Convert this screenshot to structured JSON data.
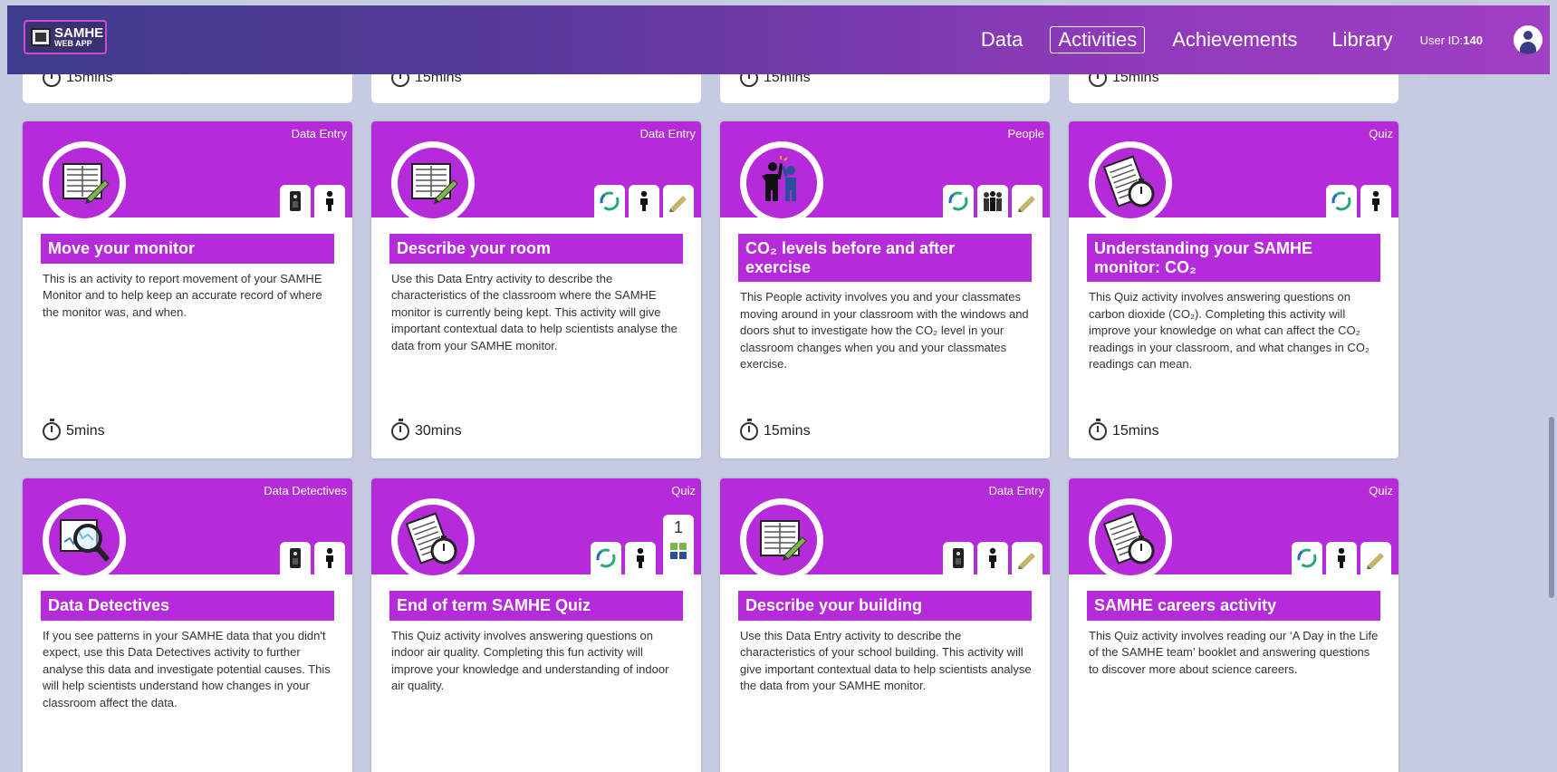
{
  "header": {
    "logo_title": "SAMHE",
    "logo_sub": "WEB APP",
    "nav": [
      {
        "label": "Data"
      },
      {
        "label": "Activities"
      },
      {
        "label": "Achievements"
      },
      {
        "label": "Library"
      }
    ],
    "user_id_label": "User ID:",
    "user_id_value": "140"
  },
  "partial_row": [
    {
      "duration": "15mins"
    },
    {
      "duration": "15mins"
    },
    {
      "duration": "15mins"
    },
    {
      "duration": "15mins"
    }
  ],
  "cards": [
    {
      "category": "Data Entry",
      "title": "Move your monitor",
      "description": "This is an activity to report movement of your SAMHE Monitor and to help keep an accurate record of where the monitor was, and when.",
      "duration": "5mins",
      "icon": "data-entry-sheet-icon",
      "badges": [
        "monitor-icon",
        "person-icon"
      ]
    },
    {
      "category": "Data Entry",
      "title": "Describe your room",
      "description": "Use this Data Entry activity to describe the characteristics of the classroom where the SAMHE monitor is currently being kept. This activity will give important contextual data to help scientists analyse the data from your SAMHE monitor.",
      "duration": "30mins",
      "icon": "data-entry-sheet-icon",
      "badges": [
        "repeat-icon",
        "person-icon",
        "pencil-icon"
      ]
    },
    {
      "category": "People",
      "title": "CO₂ levels before and after exercise",
      "description": "This People activity involves you and your classmates moving around in your classroom with the windows and doors shut to investigate how the CO₂ level in your classroom changes when you and your classmates exercise.",
      "duration": "15mins",
      "icon": "people-high-five-icon",
      "badges": [
        "repeat-icon",
        "group-icon",
        "pencil-icon"
      ]
    },
    {
      "category": "Quiz",
      "title": "Understanding your SAMHE monitor: CO₂",
      "description": "This Quiz activity involves answering questions on carbon dioxide (CO₂). Completing this activity will improve your knowledge on what can affect the CO₂ readings in your classroom, and what changes in CO₂ readings can mean.",
      "duration": "15mins",
      "icon": "quiz-sheet-icon",
      "badges": [
        "repeat-icon",
        "person-icon"
      ]
    },
    {
      "category": "Data Detectives",
      "title": "Data Detectives",
      "description": "If you see patterns in your SAMHE data that you didn't expect, use this Data Detectives activity to further analyse this data and investigate potential causes. This will help scientists understand how changes in your classroom affect the data.",
      "duration": "",
      "icon": "magnifier-chart-icon",
      "badges": [
        "monitor-icon",
        "person-icon"
      ]
    },
    {
      "category": "Quiz",
      "title": "End of term SAMHE Quiz",
      "description": "This Quiz activity involves answering questions on indoor air quality. Completing this fun activity will improve your knowledge and understanding of indoor air quality.",
      "duration": "",
      "icon": "quiz-sheet-icon",
      "badges": [
        "repeat-icon",
        "person-icon"
      ],
      "count_badge": "1"
    },
    {
      "category": "Data Entry",
      "title": "Describe your building",
      "description": "Use this Data Entry activity to describe the characteristics of your school building. This activity will give important contextual data to help scientists analyse the data from your SAMHE monitor.",
      "duration": "",
      "icon": "data-entry-sheet-icon",
      "badges": [
        "monitor-icon",
        "person-icon",
        "pencil-icon"
      ]
    },
    {
      "category": "Quiz",
      "title": "SAMHE careers activity",
      "description": "This Quiz activity involves reading our ‘A Day in the Life of the SAMHE team’ booklet and answering questions to discover more about science careers.",
      "duration": "",
      "icon": "quiz-sheet-icon",
      "badges": [
        "repeat-icon",
        "person-icon",
        "pencil-icon"
      ]
    }
  ],
  "colors": {
    "accent": "#b52bd9",
    "header_start": "#3e3c8c",
    "header_end": "#a03fc4",
    "page_bg": "#c5cbe0"
  }
}
